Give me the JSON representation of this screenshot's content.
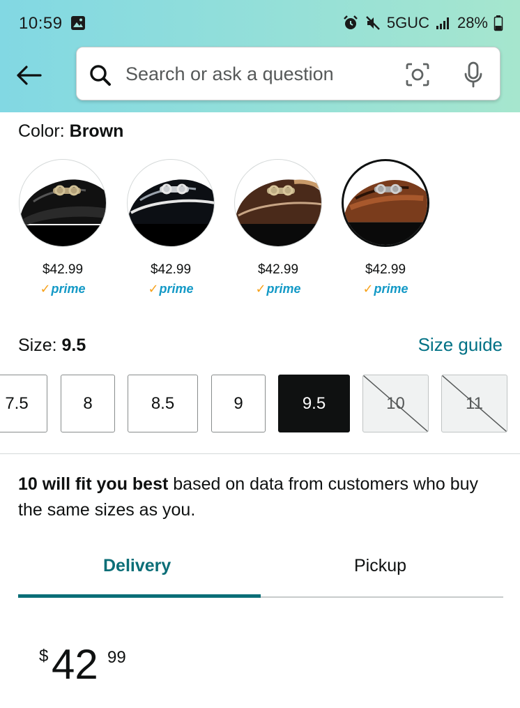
{
  "status_bar": {
    "time": "10:59",
    "network": "5GUC",
    "battery": "28%"
  },
  "search": {
    "placeholder": "Search or ask a question"
  },
  "color": {
    "label": "Color: ",
    "value": "Brown",
    "swatches": [
      {
        "price": "$42.99",
        "prime": "prime",
        "finish": "black-patent"
      },
      {
        "price": "$42.99",
        "prime": "prime",
        "finish": "black-glossy"
      },
      {
        "price": "$42.99",
        "prime": "prime",
        "finish": "dark-brown"
      },
      {
        "price": "$42.99",
        "prime": "prime",
        "finish": "brown"
      }
    ],
    "selected_index": 3
  },
  "size": {
    "label": "Size: ",
    "value": "9.5",
    "guide_link": "Size guide",
    "options": [
      {
        "label": "7.5",
        "state": "available"
      },
      {
        "label": "8",
        "state": "available"
      },
      {
        "label": "8.5",
        "state": "available"
      },
      {
        "label": "9",
        "state": "available"
      },
      {
        "label": "9.5",
        "state": "selected"
      },
      {
        "label": "10",
        "state": "unavailable"
      },
      {
        "label": "11",
        "state": "unavailable"
      }
    ]
  },
  "fit": {
    "bold": "10 will fit you best",
    "rest": " based on data from customers who buy the same sizes as you."
  },
  "tabs": {
    "delivery": "Delivery",
    "pickup": "Pickup",
    "active": "delivery"
  },
  "price": {
    "symbol": "$",
    "whole": "42",
    "fraction": "99"
  },
  "colors": {
    "accent_teal": "#007185",
    "tab_teal": "#0b6e77",
    "prime_blue": "#1399c6",
    "prime_check": "#f7a21b"
  }
}
